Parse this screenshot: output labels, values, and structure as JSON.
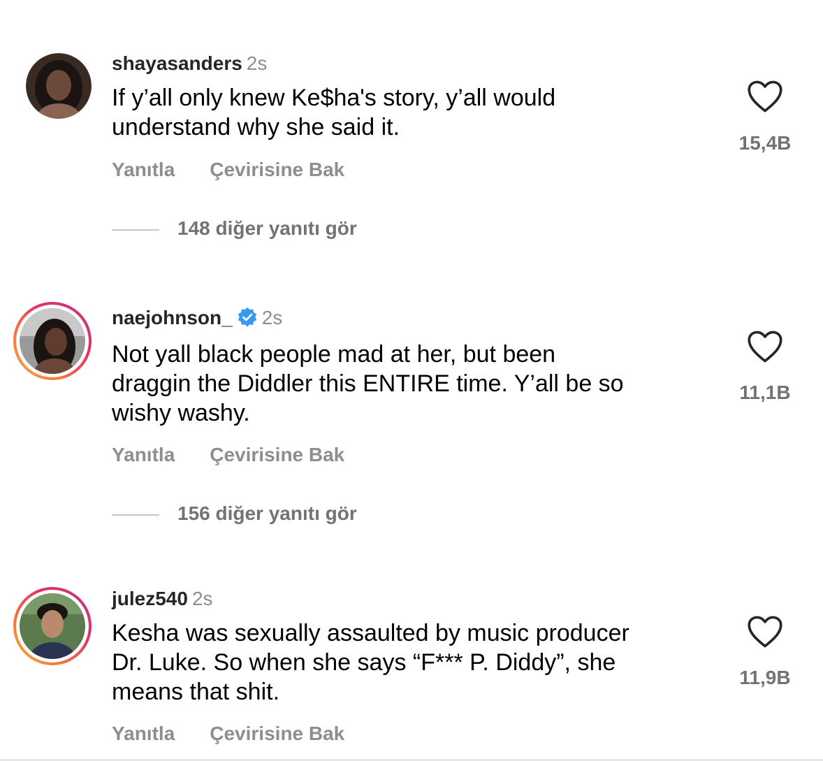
{
  "comments": [
    {
      "username": "shayasanders",
      "time": "2s",
      "verified": false,
      "text_lines": [
        "If y’all only knew Ke$ha's story, y’all would",
        "understand why she said it."
      ],
      "reply_label": "Yanıtla",
      "translate_label": "Çevirisine Bak",
      "likes": "15,4B",
      "more_replies": "148 diğer yanıtı gör"
    },
    {
      "username": "naejohnson_",
      "time": "2s",
      "verified": true,
      "text_lines": [
        "Not yall black people mad at her, but been",
        "draggin the Diddler this ENTIRE time. Y’all be so",
        "wishy washy."
      ],
      "reply_label": "Yanıtla",
      "translate_label": "Çevirisine Bak",
      "likes": "11,1B",
      "more_replies": "156 diğer yanıtı gör"
    },
    {
      "username": "julez540",
      "time": "2s",
      "verified": false,
      "text_lines": [
        "Kesha was sexually assaulted by music producer",
        "Dr. Luke. So when she says “F*** P. Diddy”, she",
        "means that shit."
      ],
      "reply_label": "Yanıtla",
      "translate_label": "Çevirisine Bak",
      "likes": "11,9B"
    }
  ],
  "icons": {
    "like": "heart-outline-icon",
    "verified": "verified-badge-icon"
  },
  "colors": {
    "text": "#000000",
    "username": "#262626",
    "secondary": "#8e8e8e",
    "verified": "#3897f0"
  }
}
